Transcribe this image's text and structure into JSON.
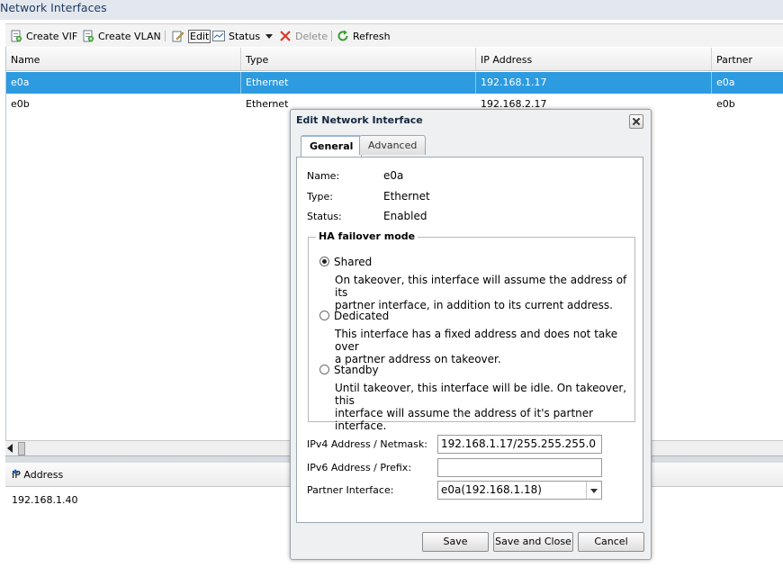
{
  "panel": {
    "title": "Network Interfaces"
  },
  "toolbar": {
    "create_vif": "Create VIF",
    "create_vlan": "Create VLAN",
    "edit": "Edit",
    "status": "Status",
    "delete": "Delete",
    "refresh": "Refresh"
  },
  "grid": {
    "columns": [
      "Name",
      "Type",
      "IP Address",
      "Partner"
    ],
    "rows": [
      {
        "name": "e0a",
        "type": "Ethernet",
        "ip": "192.168.1.17",
        "partner": "e0a",
        "selected": true
      },
      {
        "name": "e0b",
        "type": "Ethernet",
        "ip": "192.168.2.17",
        "partner": "e0b",
        "selected": false
      }
    ]
  },
  "lower": {
    "column": "IP Address",
    "rows": [
      "192.168.1.40"
    ]
  },
  "dialog": {
    "title": "Edit Network Interface",
    "tabs": [
      "General",
      "Advanced"
    ],
    "active_tab": "General",
    "name_label": "Name:",
    "name_value": "e0a",
    "type_label": "Type:",
    "type_value": "Ethernet",
    "status_label": "Status:",
    "status_value": "Enabled",
    "ha_legend": "HA failover mode",
    "options": [
      {
        "label": "Shared",
        "selected": true,
        "desc1": "On takeover, this interface will assume the address of its",
        "desc2": "partner interface, in addition to its current address."
      },
      {
        "label": "Dedicated",
        "selected": false,
        "desc1": "This interface has a fixed address and does not take over",
        "desc2": "a partner address on takeover."
      },
      {
        "label": "Standby",
        "selected": false,
        "desc1": "Until takeover, this interface will be idle. On takeover, this",
        "desc2": "interface will assume the address of it's partner interface."
      }
    ],
    "ipv4_label": "IPv4 Address / Netmask:",
    "ipv4_value": "192.168.1.17/255.255.255.0",
    "ipv6_label": "IPv6 Address / Prefix:",
    "ipv6_value": "",
    "partner_label": "Partner Interface:",
    "partner_value": "e0a(192.168.1.18)",
    "save": "Save",
    "save_close": "Save and Close",
    "cancel": "Cancel"
  },
  "colors": {
    "selection": "#2d9be0",
    "title_text": "#1f3b63",
    "delete_red": "#d9392b",
    "refresh_green": "#3d9a36"
  }
}
